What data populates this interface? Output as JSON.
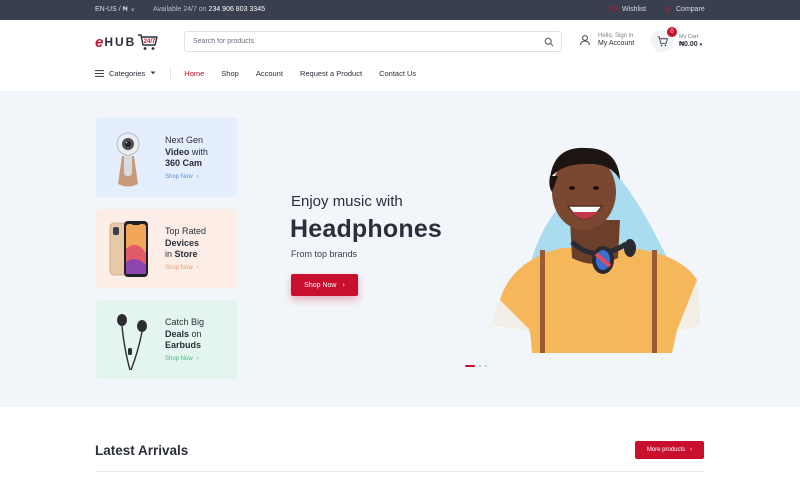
{
  "topbar": {
    "locale": "EN-US / ₦",
    "availability_prefix": "Available 24/7 on",
    "phone": "234 906 803 3345",
    "wishlist": "Wishlist",
    "compare": "Compare"
  },
  "header": {
    "logo_e": "e",
    "logo_hub": "HUB",
    "logo_badge": "24/7",
    "search_placeholder": "Search for products",
    "account_greeting": "Hello, Sign in",
    "account_label": "My Account",
    "cart_label": "My Cart",
    "cart_total": "₦0.00",
    "cart_count": "0"
  },
  "nav": {
    "categories": "Categories",
    "items": [
      "Home",
      "Shop",
      "Account",
      "Request a Product",
      "Contact Us"
    ],
    "active": "Home"
  },
  "promos": [
    {
      "line1": "Next Gen",
      "line2_bold": "Video",
      "line2_rest": " with",
      "line3_bold": "360 Cam",
      "line3_rest": "",
      "cta": "Shop Now",
      "color": "#5f93d9"
    },
    {
      "line1": "Top Rated",
      "line2_bold": "Devices",
      "line2_rest": "",
      "line3_pre": "in ",
      "line3_bold": "Store",
      "cta": "Shop Now",
      "color": "#ec9c74"
    },
    {
      "line1": "Catch Big",
      "line2_bold": "Deals",
      "line2_rest": " on",
      "line3_bold": "Earbuds",
      "line3_rest": "",
      "cta": "Shop Now",
      "color": "#45b884"
    }
  ],
  "hero": {
    "subtitle": "Enjoy music with",
    "title": "Headphones",
    "tagline": "From top brands",
    "cta": "Shop Now"
  },
  "latest": {
    "title": "Latest Arrivals",
    "more": "More products"
  },
  "colors": {
    "accent": "#c8102e",
    "topbar": "#3a3f4f",
    "hero_bg": "#f2f5fa"
  }
}
